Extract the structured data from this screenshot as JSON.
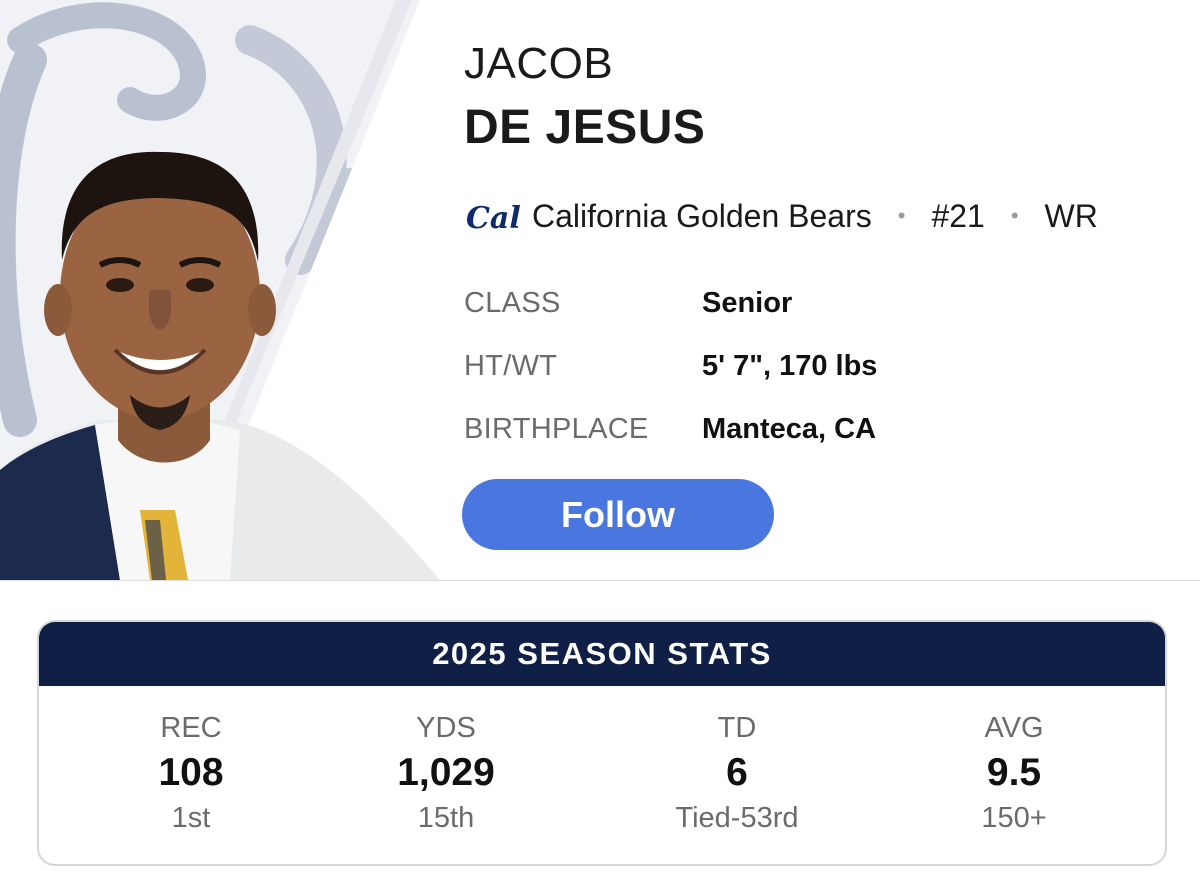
{
  "player": {
    "first_name": "JACOB",
    "last_name": "DE JESUS",
    "team": "California Golden Bears",
    "team_logo_text": "Cal",
    "number": "#21",
    "position": "WR",
    "separator": "•"
  },
  "info": [
    {
      "label": "CLASS",
      "value": "Senior"
    },
    {
      "label": "HT/WT",
      "value": "5' 7\", 170 lbs"
    },
    {
      "label": "BIRTHPLACE",
      "value": "Manteca, CA"
    }
  ],
  "follow_label": "Follow",
  "stats": {
    "title": "2025 SEASON STATS",
    "columns": [
      {
        "label": "REC",
        "value": "108",
        "rank": "1st"
      },
      {
        "label": "YDS",
        "value": "1,029",
        "rank": "15th"
      },
      {
        "label": "TD",
        "value": "6",
        "rank": "Tied-53rd"
      },
      {
        "label": "AVG",
        "value": "9.5",
        "rank": "150+"
      }
    ]
  },
  "colors": {
    "team_navy": "#0f1f45",
    "team_gold": "#e2b53a",
    "follow_blue": "#4a76e0",
    "label_gray": "#6b6b6b"
  }
}
